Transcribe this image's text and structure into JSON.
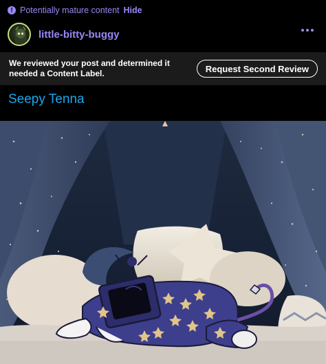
{
  "mature_notice": {
    "icon": "info-icon",
    "text": "Potentially mature content",
    "hide_label": "Hide",
    "color": "#9b87f5"
  },
  "post": {
    "username": "little-bitty-buggy",
    "more_icon": "more-options-icon",
    "title": "Seepy Tenna"
  },
  "content_label": {
    "message": "We reviewed your post and determined it needed a Content Label.",
    "button_label": "Request Second Review"
  },
  "colors": {
    "accent": "#9b87f5",
    "title_link": "#1aa7ec",
    "banner_bg": "#1b1b1b"
  }
}
